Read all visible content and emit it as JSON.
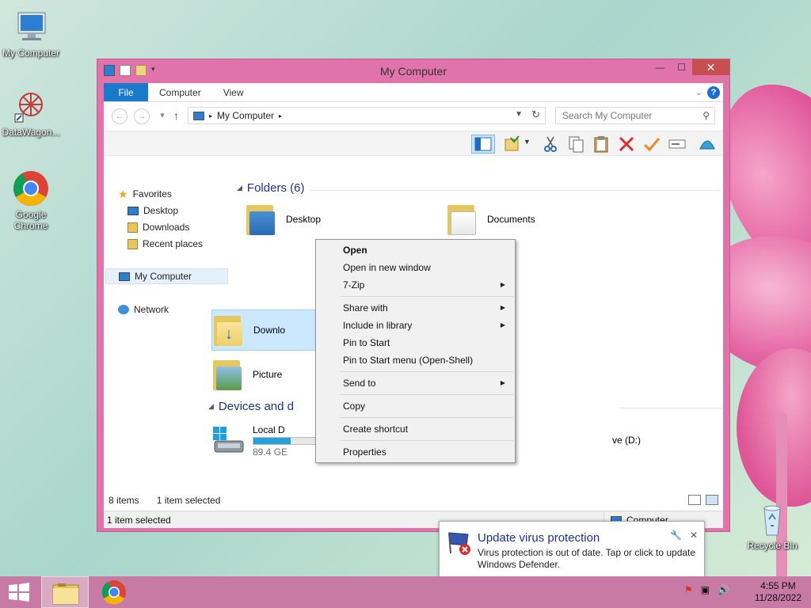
{
  "desktop": {
    "icons": [
      {
        "label": "My Computer"
      },
      {
        "label": "DataWagon..."
      },
      {
        "label": "Google Chrome"
      },
      {
        "label": "Recycle Bin"
      }
    ]
  },
  "window": {
    "title": "My Computer",
    "close_glyph": "✕",
    "min_glyph": "—",
    "max_glyph": "☐"
  },
  "ribbon": {
    "tabs": [
      "File",
      "Computer",
      "View"
    ]
  },
  "address": {
    "path": "My Computer",
    "search_placeholder": "Search My Computer"
  },
  "nav": {
    "favorites": "Favorites",
    "desktop": "Desktop",
    "downloads": "Downloads",
    "recent": "Recent places",
    "my_computer": "My Computer",
    "network": "Network"
  },
  "content": {
    "folders_header": "Folders (6)",
    "devices_header": "Devices and d",
    "folders": [
      {
        "label": "Desktop"
      },
      {
        "label": "Documents"
      },
      {
        "label": "Downlo"
      },
      {
        "label": "Picture"
      }
    ],
    "drives": [
      {
        "label": "Local D",
        "size": "89.4 GE",
        "fill": 0.3
      },
      {
        "label": "ve (D:)"
      }
    ]
  },
  "status": {
    "items": "8 items",
    "selected": "1 item selected",
    "bar_text": "1 item selected",
    "computer": "Computer"
  },
  "context_menu": {
    "items": [
      {
        "label": "Open",
        "bold": true,
        "sub": false
      },
      {
        "label": "Open in new window",
        "sub": false
      },
      {
        "label": "7-Zip",
        "sub": true
      },
      {
        "label": "Share with",
        "sub": true
      },
      {
        "label": "Include in library",
        "sub": true
      },
      {
        "label": "Pin to Start",
        "sub": false
      },
      {
        "label": "Pin to Start menu (Open-Shell)",
        "sub": false
      },
      {
        "label": "Send to",
        "sub": true
      },
      {
        "label": "Copy",
        "sub": false
      },
      {
        "label": "Create shortcut",
        "sub": false
      },
      {
        "label": "Properties",
        "sub": false
      }
    ]
  },
  "toast": {
    "title": "Update virus protection",
    "body": "Virus protection is out of date. Tap or click to update Windows Defender."
  },
  "taskbar": {
    "time": "4:55 PM",
    "date": "11/28/2022"
  },
  "colors": {
    "accent": "#1979ca",
    "window_frame": "#e173ab",
    "taskbar": "#c77ba4",
    "header_text": "#1e3287"
  }
}
